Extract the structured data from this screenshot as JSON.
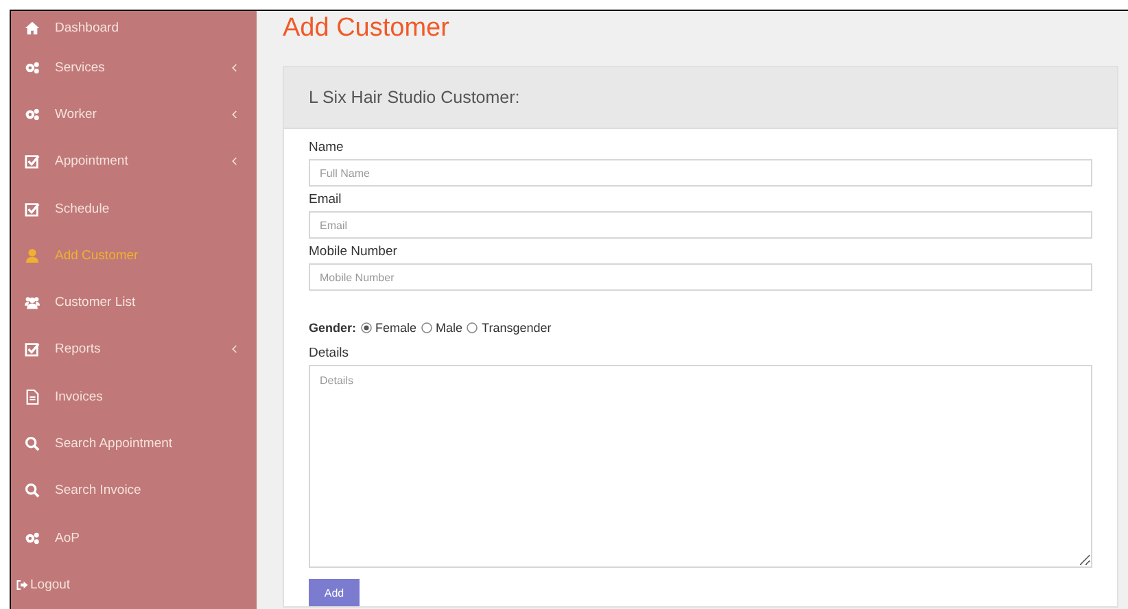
{
  "sidebar": {
    "items": [
      {
        "label": "Dashboard",
        "kind": "home",
        "selected": false,
        "has_submenu": false
      },
      {
        "label": "Services",
        "kind": "gears",
        "selected": false,
        "has_submenu": true
      },
      {
        "label": "Worker",
        "kind": "gears",
        "selected": false,
        "has_submenu": true
      },
      {
        "label": "Appointment",
        "kind": "check",
        "selected": false,
        "has_submenu": true
      },
      {
        "label": "Schedule",
        "kind": "check",
        "selected": false,
        "has_submenu": false
      },
      {
        "label": "Add Customer",
        "kind": "user",
        "selected": true,
        "has_submenu": false
      },
      {
        "label": "Customer List",
        "kind": "users",
        "selected": false,
        "has_submenu": false
      },
      {
        "label": "Reports",
        "kind": "check",
        "selected": false,
        "has_submenu": true
      },
      {
        "label": "Invoices",
        "kind": "file",
        "selected": false,
        "has_submenu": false
      },
      {
        "label": "Search Appointment",
        "kind": "search",
        "selected": false,
        "has_submenu": false
      },
      {
        "label": "Search Invoice",
        "kind": "search",
        "selected": false,
        "has_submenu": false
      },
      {
        "label": "AoP",
        "kind": "gears",
        "selected": false,
        "has_submenu": false
      },
      {
        "label": "Logout",
        "kind": "logout",
        "selected": false,
        "has_submenu": false
      }
    ]
  },
  "page_title": "Add Customer",
  "card": {
    "title": "L Six Hair Studio Customer:",
    "fields": [
      {
        "label": "Name",
        "placeholder": "Full Name"
      },
      {
        "label": "Email",
        "placeholder": "Email"
      },
      {
        "label": "Mobile Number",
        "placeholder": "Mobile Number"
      }
    ],
    "gender": {
      "label": "Gender:",
      "options": [
        {
          "label": "Female",
          "selected": true
        },
        {
          "label": "Male",
          "selected": false
        },
        {
          "label": "Transgender",
          "selected": false
        }
      ]
    },
    "details": {
      "label": "Details",
      "placeholder": "Details"
    },
    "submit": "Add"
  }
}
